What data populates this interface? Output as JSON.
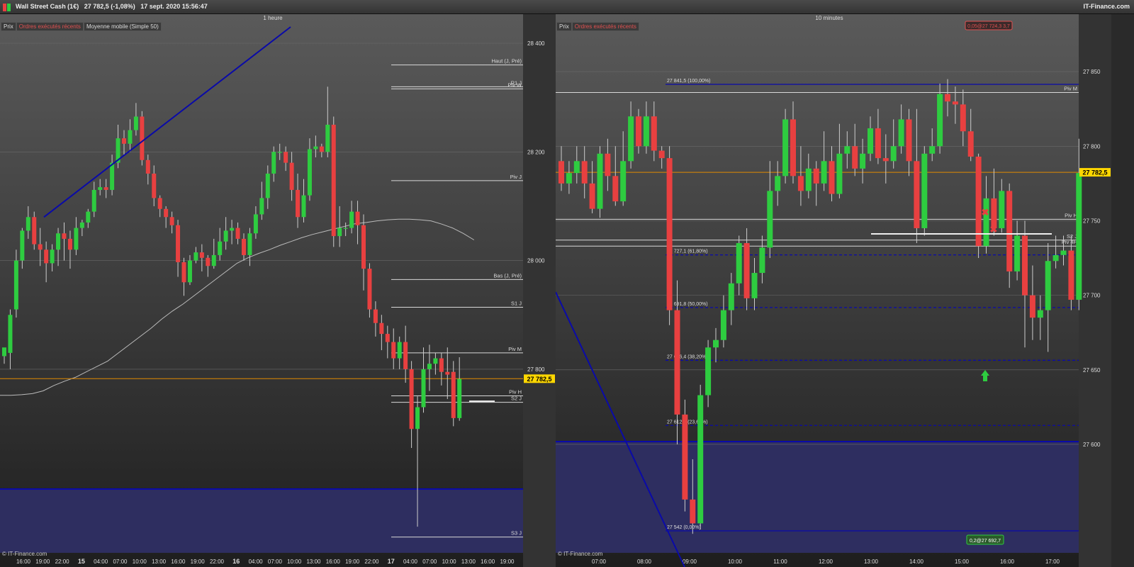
{
  "header": {
    "title": "Wall Street Cash (1€)   27 782,5 (-1,08%)   17 sept. 2020 15:56:47",
    "brand": "IT-Finance.com"
  },
  "tabs": [
    "Prix",
    "Ordres exécutés récents",
    "Moyenne mobile (Simple 50)"
  ],
  "copyright": "© IT-Finance.com",
  "colors": {
    "up": "#2ecc40",
    "down": "#e84040",
    "current": "#e08a00",
    "trend": "#0a0aa8",
    "zone": "#2e2e60",
    "label_bg": "#ffd700"
  },
  "chart_data": [
    {
      "type": "candlestick",
      "title": "1 heure",
      "ylim": [
        27475,
        28430
      ],
      "yticks": [
        {
          "v": 28400,
          "t": "28 400"
        },
        {
          "v": 28200,
          "t": "28 200"
        },
        {
          "v": 28000,
          "t": "28 000"
        },
        {
          "v": 27800,
          "t": "27 800"
        }
      ],
      "xticks": [
        "16:00",
        "19:00",
        "22:00",
        "15",
        "04:00",
        "07:00",
        "10:00",
        "13:00",
        "16:00",
        "19:00",
        "22:00",
        "16",
        "04:00",
        "07:00",
        "10:00",
        "13:00",
        "16:00",
        "19:00",
        "22:00",
        "17",
        "04:00",
        "07:00",
        "10:00",
        "13:00",
        "16:00",
        "19:00"
      ],
      "current": {
        "value": 27782.5,
        "label": "27 782,5"
      },
      "levels": [
        {
          "v": 28360,
          "t": "Haut (J, Pré)"
        },
        {
          "v": 28320,
          "t": "R1 J"
        },
        {
          "v": 28316,
          "t": "Piv W"
        },
        {
          "v": 28147,
          "t": "Piv J"
        },
        {
          "v": 27965,
          "t": "Bas (J, Pré)"
        },
        {
          "v": 27914,
          "t": "S1 J"
        },
        {
          "v": 27830,
          "t": "Piv M"
        },
        {
          "v": 27751,
          "t": "Piv H"
        },
        {
          "v": 27739,
          "t": "S2 J"
        },
        {
          "v": 27491,
          "t": "S3 J"
        }
      ],
      "candles": [
        [
          27824,
          27840,
          27810,
          27830
        ],
        [
          27830,
          27900,
          27800,
          27910
        ],
        [
          27910,
          28000,
          27895,
          28020
        ],
        [
          28000,
          28055,
          27985,
          28060
        ],
        [
          28055,
          28080,
          28040,
          28100
        ],
        [
          28080,
          28030,
          28020,
          28090
        ],
        [
          28030,
          28020,
          27990,
          28060
        ],
        [
          28020,
          27995,
          27960,
          28035
        ],
        [
          27995,
          28020,
          27980,
          28030
        ],
        [
          28020,
          28050,
          27990,
          28060
        ],
        [
          28050,
          28040,
          28000,
          28070
        ],
        [
          28040,
          28020,
          27985,
          28055
        ],
        [
          28020,
          28060,
          28010,
          28080
        ],
        [
          28060,
          28070,
          28045,
          28075
        ],
        [
          28070,
          28090,
          28060,
          28095
        ],
        [
          28090,
          28130,
          28080,
          28145
        ],
        [
          28130,
          28135,
          28120,
          28150
        ],
        [
          28135,
          28130,
          28115,
          28150
        ],
        [
          28130,
          28180,
          28120,
          28195
        ],
        [
          28180,
          28225,
          28170,
          28250
        ],
        [
          28225,
          28215,
          28195,
          28240
        ],
        [
          28215,
          28240,
          28200,
          28260
        ],
        [
          28240,
          28265,
          28230,
          28290
        ],
        [
          28265,
          28185,
          28175,
          28275
        ],
        [
          28185,
          28160,
          28140,
          28195
        ],
        [
          28160,
          28115,
          28100,
          28175
        ],
        [
          28115,
          28095,
          28080,
          28120
        ],
        [
          28095,
          28080,
          28060,
          28100
        ],
        [
          28080,
          28065,
          28050,
          28090
        ],
        [
          28065,
          27997,
          27970,
          28075
        ],
        [
          27997,
          27960,
          27935,
          28005
        ],
        [
          27960,
          28000,
          27955,
          28010
        ],
        [
          28000,
          28015,
          27995,
          28025
        ],
        [
          28015,
          28005,
          27980,
          28030
        ],
        [
          28005,
          27990,
          27970,
          28010
        ],
        [
          27990,
          28010,
          27985,
          28040
        ],
        [
          28010,
          28035,
          28000,
          28060
        ],
        [
          28035,
          28055,
          28020,
          28080
        ],
        [
          28055,
          28060,
          28030,
          28075
        ],
        [
          28060,
          28040,
          28030,
          28070
        ],
        [
          28040,
          28010,
          28000,
          28050
        ],
        [
          28010,
          28050,
          27990,
          28060
        ],
        [
          28050,
          28085,
          28040,
          28100
        ],
        [
          28085,
          28115,
          28075,
          28145
        ],
        [
          28115,
          28160,
          28095,
          28175
        ],
        [
          28160,
          28200,
          28145,
          28210
        ],
        [
          28200,
          28200,
          28185,
          28215
        ],
        [
          28200,
          28180,
          28165,
          28210
        ],
        [
          28180,
          28130,
          28110,
          28200
        ],
        [
          28130,
          28080,
          28060,
          28160
        ],
        [
          28080,
          28120,
          28070,
          28150
        ],
        [
          28120,
          28205,
          28110,
          28225
        ],
        [
          28205,
          28210,
          28190,
          28230
        ],
        [
          28210,
          28200,
          28190,
          28215
        ],
        [
          28200,
          28250,
          28190,
          28320
        ],
        [
          28250,
          28045,
          28025,
          28265
        ],
        [
          28045,
          28060,
          28025,
          28100
        ],
        [
          28060,
          28060,
          28045,
          28070
        ],
        [
          28060,
          28090,
          28050,
          28110
        ],
        [
          28090,
          28065,
          28030,
          28110
        ],
        [
          28065,
          27985,
          27945,
          28085
        ],
        [
          27985,
          27910,
          27895,
          27995
        ],
        [
          27910,
          27885,
          27860,
          27925
        ],
        [
          27885,
          27865,
          27835,
          27900
        ],
        [
          27865,
          27850,
          27820,
          27880
        ],
        [
          27850,
          27820,
          27800,
          27875
        ],
        [
          27820,
          27850,
          27800,
          27860
        ],
        [
          27850,
          27800,
          27775,
          27880
        ],
        [
          27800,
          27690,
          27655,
          27815
        ],
        [
          27690,
          27730,
          27510,
          27750
        ],
        [
          27730,
          27800,
          27720,
          27840
        ],
        [
          27800,
          27810,
          27760,
          27845
        ],
        [
          27810,
          27820,
          27790,
          27830
        ],
        [
          27820,
          27795,
          27770,
          27830
        ],
        [
          27795,
          27790,
          27745,
          27840
        ],
        [
          27795,
          27710,
          27695,
          27815
        ],
        [
          27710,
          27782,
          27705,
          27822
        ]
      ],
      "ma_label": "Moyenne mobile (Simple 50)",
      "moving_average": [
        27752,
        27752,
        27753,
        27755,
        27760,
        27770,
        27778,
        27785,
        27795,
        27805,
        27815,
        27830,
        27845,
        27860,
        27875,
        27892,
        27907,
        27920,
        27935,
        27950,
        27965,
        27980,
        27995,
        28005,
        28013,
        28020,
        28028,
        28035,
        28042,
        28048,
        28053,
        28058,
        28063,
        28068,
        28070,
        28073,
        28075,
        28076,
        28076,
        28075,
        28073,
        28067,
        28060,
        28050,
        28038
      ]
    },
    {
      "type": "candlestick",
      "title": "10 minutes",
      "ylim": [
        27532,
        27880
      ],
      "yticks": [
        {
          "v": 27850,
          "t": "27 850"
        },
        {
          "v": 27800,
          "t": "27 800"
        },
        {
          "v": 27750,
          "t": "27 750"
        },
        {
          "v": 27700,
          "t": "27 700"
        },
        {
          "v": 27650,
          "t": "27 650"
        },
        {
          "v": 27600,
          "t": "27 600"
        }
      ],
      "xticks": [
        "07:00",
        "08:00",
        "09:00",
        "10:00",
        "11:00",
        "12:00",
        "13:00",
        "14:00",
        "15:00",
        "16:00",
        "17:00"
      ],
      "current": {
        "value": 27782.5,
        "label": "27 782,5"
      },
      "order_top": "0,05@27 724,3 3,7",
      "order_bottom": "0,2@27 692,7",
      "levels": [
        {
          "v": 27836,
          "t": "Piv M"
        },
        {
          "v": 27751,
          "t": "Piv H"
        },
        {
          "v": 27737,
          "t": "S2 J"
        },
        {
          "v": 27733,
          "t": "Piv 4H"
        }
      ],
      "fib": [
        {
          "v": 27841.5,
          "t": "27 841,5 (100,00%)"
        },
        {
          "v": 27727.1,
          "t": "27 727,1 (61,80%)"
        },
        {
          "v": 27691.8,
          "t": "27 691,8 (50,00%)"
        },
        {
          "v": 27656.4,
          "t": "27 656,4 (38,20%)"
        },
        {
          "v": 27612.7,
          "t": "27 612,7 (23,60%)"
        },
        {
          "v": 27542,
          "t": "27 542 (0,00%)"
        }
      ],
      "candles": [
        [
          27790,
          27775,
          27770,
          27800
        ],
        [
          27775,
          27782,
          27768,
          27790
        ],
        [
          27782,
          27790,
          27775,
          27800
        ],
        [
          27790,
          27775,
          27765,
          27800
        ],
        [
          27775,
          27758,
          27755,
          27790
        ],
        [
          27758,
          27795,
          27752,
          27800
        ],
        [
          27795,
          27780,
          27770,
          27805
        ],
        [
          27780,
          27763,
          27760,
          27800
        ],
        [
          27763,
          27790,
          27760,
          27810
        ],
        [
          27790,
          27820,
          27785,
          27830
        ],
        [
          27820,
          27800,
          27795,
          27825
        ],
        [
          27800,
          27820,
          27795,
          27830
        ],
        [
          27820,
          27797,
          27790,
          27830
        ],
        [
          27797,
          27792,
          27785,
          27800
        ],
        [
          27792,
          27690,
          27680,
          27800
        ],
        [
          27690,
          27620,
          27600,
          27710
        ],
        [
          27620,
          27563,
          27555,
          27630
        ],
        [
          27563,
          27547,
          27540,
          27590
        ],
        [
          27547,
          27633,
          27543,
          27640
        ],
        [
          27633,
          27665,
          27625,
          27670
        ],
        [
          27665,
          27670,
          27655,
          27678
        ],
        [
          27670,
          27690,
          27665,
          27700
        ],
        [
          27690,
          27708,
          27680,
          27715
        ],
        [
          27708,
          27735,
          27700,
          27740
        ],
        [
          27735,
          27698,
          27690,
          27745
        ],
        [
          27698,
          27715,
          27690,
          27725
        ],
        [
          27715,
          27732,
          27708,
          27740
        ],
        [
          27732,
          27770,
          27725,
          27790
        ],
        [
          27770,
          27780,
          27760,
          27790
        ],
        [
          27780,
          27818,
          27775,
          27825
        ],
        [
          27818,
          27780,
          27775,
          27830
        ],
        [
          27780,
          27770,
          27760,
          27800
        ],
        [
          27770,
          27785,
          27765,
          27795
        ],
        [
          27785,
          27775,
          27760,
          27790
        ],
        [
          27775,
          27790,
          27770,
          27810
        ],
        [
          27790,
          27768,
          27763,
          27800
        ],
        [
          27768,
          27795,
          27765,
          27815
        ],
        [
          27795,
          27800,
          27785,
          27810
        ],
        [
          27800,
          27785,
          27780,
          27815
        ],
        [
          27785,
          27795,
          27775,
          27805
        ],
        [
          27795,
          27812,
          27790,
          27820
        ],
        [
          27812,
          27792,
          27788,
          27825
        ],
        [
          27792,
          27790,
          27775,
          27808
        ],
        [
          27790,
          27800,
          27785,
          27818
        ],
        [
          27800,
          27818,
          27795,
          27828
        ],
        [
          27818,
          27790,
          27780,
          27825
        ],
        [
          27790,
          27745,
          27735,
          27825
        ],
        [
          27745,
          27795,
          27740,
          27800
        ],
        [
          27795,
          27800,
          27790,
          27812
        ],
        [
          27800,
          27835,
          27795,
          27842
        ],
        [
          27835,
          27830,
          27820,
          27845
        ],
        [
          27830,
          27828,
          27815,
          27840
        ],
        [
          27828,
          27810,
          27800,
          27838
        ],
        [
          27810,
          27793,
          27790,
          27825
        ],
        [
          27793,
          27733,
          27725,
          27795
        ],
        [
          27733,
          27765,
          27728,
          27780
        ],
        [
          27765,
          27745,
          27740,
          27785
        ],
        [
          27745,
          27770,
          27742,
          27778
        ],
        [
          27770,
          27716,
          27705,
          27775
        ],
        [
          27716,
          27740,
          27710,
          27750
        ],
        [
          27740,
          27700,
          27665,
          27750
        ],
        [
          27700,
          27685,
          27670,
          27720
        ],
        [
          27685,
          27690,
          27670,
          27700
        ],
        [
          27690,
          27723,
          27662,
          27735
        ],
        [
          27723,
          27727,
          27718,
          27740
        ],
        [
          27727,
          27730,
          27720,
          27740
        ],
        [
          27730,
          27697,
          27690,
          27740
        ],
        [
          27697,
          27782,
          27690,
          27805
        ]
      ],
      "trend_line": [
        {
          "x": 0,
          "y": 27700
        },
        {
          "x": 20,
          "y": 27536
        }
      ]
    }
  ]
}
